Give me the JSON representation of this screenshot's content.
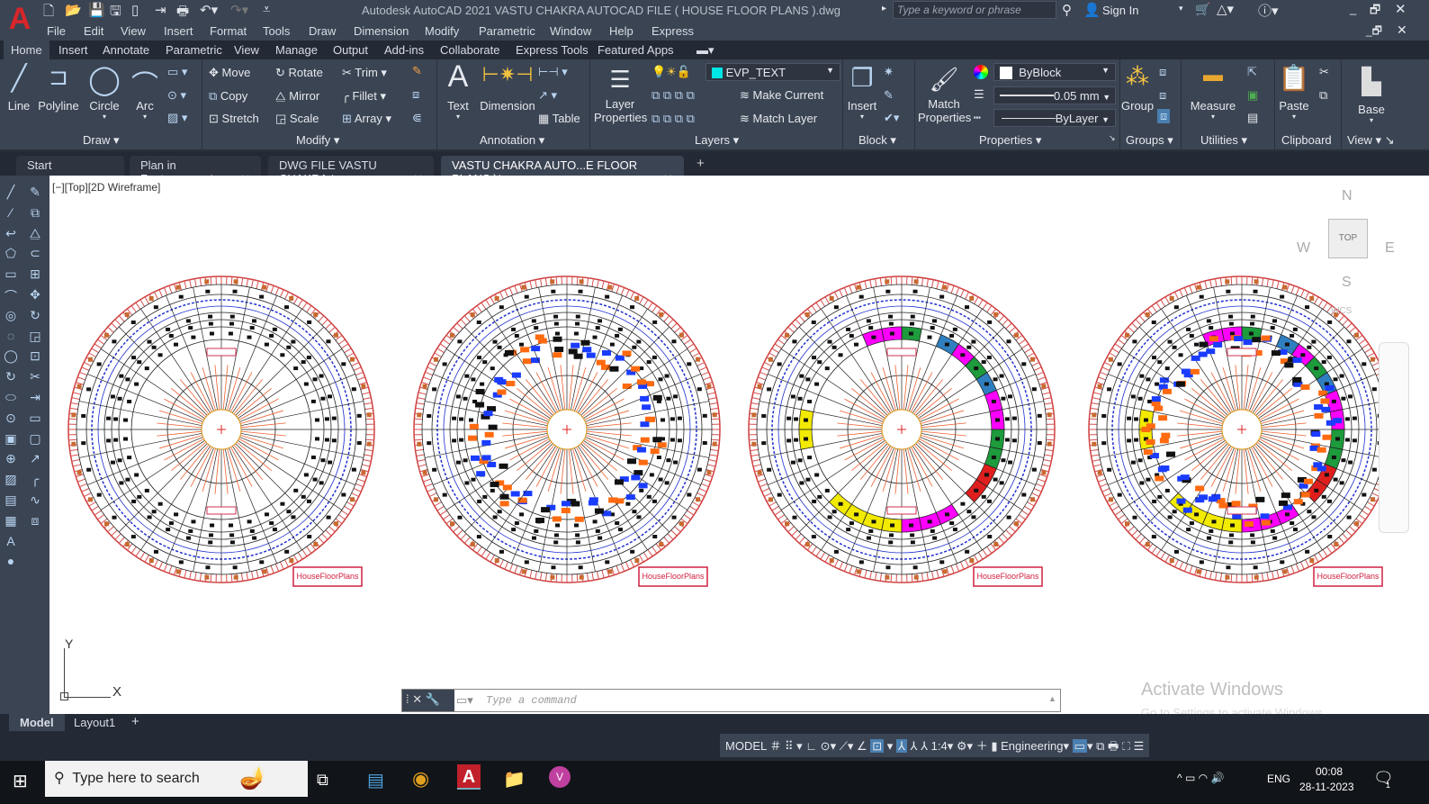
{
  "app": {
    "title": "Autodesk AutoCAD 2021    VASTU CHAKRA AUTOCAD FILE ( HOUSE FLOOR PLANS  ).dwg",
    "search_placeholder": "Type a keyword or phrase",
    "sign_in": "Sign In"
  },
  "menu": [
    "File",
    "Edit",
    "View",
    "Insert",
    "Format",
    "Tools",
    "Draw",
    "Dimension",
    "Modify",
    "Parametric",
    "Window",
    "Help",
    "Express"
  ],
  "ribbon_tabs": [
    "Home",
    "Insert",
    "Annotate",
    "Parametric",
    "View",
    "Manage",
    "Output",
    "Add-ins",
    "Collaborate",
    "Express Tools",
    "Featured Apps"
  ],
  "draw": {
    "line": "Line",
    "polyline": "Polyline",
    "circle": "Circle",
    "arc": "Arc",
    "panel": "Draw"
  },
  "modify": {
    "move": "Move",
    "rotate": "Rotate",
    "trim": "Trim",
    "copy": "Copy",
    "mirror": "Mirror",
    "fillet": "Fillet",
    "stretch": "Stretch",
    "scale": "Scale",
    "array": "Array",
    "panel": "Modify"
  },
  "annotation": {
    "text": "Text",
    "dimension": "Dimension",
    "table": "Table",
    "panel": "Annotation"
  },
  "layers": {
    "properties": "Layer Properties",
    "current_layer": "EVP_TEXT",
    "make_current": "Make Current",
    "match_layer": "Match Layer",
    "panel": "Layers",
    "layer_color": "#00e5e5"
  },
  "block": {
    "insert": "Insert",
    "panel": "Block"
  },
  "properties": {
    "match": "Match Properties",
    "color": "ByBlock",
    "lineweight": "0.05 mm",
    "linetype": "ByLayer",
    "panel": "Properties"
  },
  "groups": {
    "group": "Group",
    "panel": "Groups"
  },
  "utilities": {
    "measure": "Measure",
    "panel": "Utilities"
  },
  "clipboard": {
    "paste": "Paste",
    "panel": "Clipboard"
  },
  "view": {
    "base": "Base",
    "panel": "View"
  },
  "file_tabs": [
    "Start",
    "Plan in Feet_recover*",
    "DWG FILE VASTU CHAKRA *",
    "VASTU CHAKRA AUTO...E FLOOR PLANS  )*"
  ],
  "viewport": {
    "label": "[−][Top][2D Wireframe]",
    "viewcube": {
      "n": "N",
      "s": "S",
      "e": "E",
      "w": "W",
      "top": "TOP",
      "wcs": "WCS"
    },
    "ucs_x": "X",
    "ucs_y": "Y"
  },
  "drawing": {
    "logo_text": "HouseFloorPlans",
    "wheels": [
      {
        "variant": "plain"
      },
      {
        "variant": "dense"
      },
      {
        "variant": "ring"
      },
      {
        "variant": "ring-dense"
      }
    ],
    "ring_colors": [
      "#1e9b3c",
      "#ffffff",
      "#2f7fc0",
      "#ff00ff",
      "#1e9b3c",
      "#2f7fc0",
      "#ff00ff",
      "#ff00ff",
      "#1e9b3c",
      "#1e9b3c",
      "#e01e1e",
      "#e01e1e",
      "#ffffff",
      "#ff00ff",
      "#ff00ff",
      "#ff00ff",
      "#f2ea00",
      "#f2ea00",
      "#f2ea00",
      "#f2ea00",
      "#ffffff",
      "#ffffff",
      "#ffffff",
      "#f2ea00",
      "#f2ea00",
      "#ffffff",
      "#ffffff",
      "#ffffff",
      "#ffffff",
      "#ffffff",
      "#ff00ff",
      "#ff00ff"
    ]
  },
  "command": {
    "placeholder": "Type a command"
  },
  "layout_tabs": [
    "Model",
    "Layout1"
  ],
  "status": {
    "model": "MODEL",
    "scale": "1:4",
    "workspace": "Engineering"
  },
  "watermark": {
    "title": "Activate Windows",
    "sub": "Go to Settings to activate Windows."
  },
  "taskbar": {
    "search": "Type here to search",
    "lang": "ENG",
    "time": "00:08",
    "date": "28-11-2023",
    "notif": "1"
  }
}
